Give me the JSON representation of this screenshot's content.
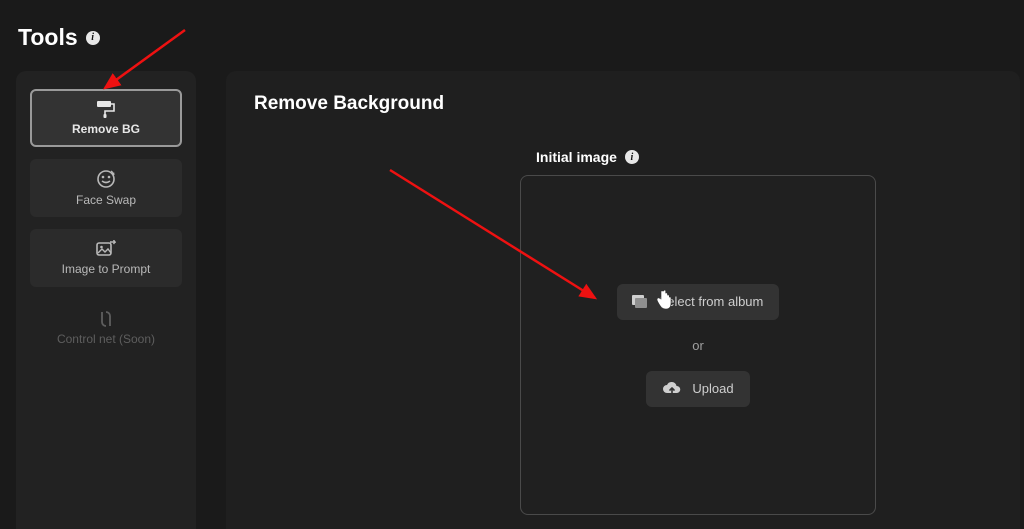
{
  "header": {
    "title": "Tools"
  },
  "sidebar": {
    "items": [
      {
        "label": "Remove BG",
        "active": true
      },
      {
        "label": "Face Swap",
        "active": false
      },
      {
        "label": "Image to Prompt",
        "active": false
      },
      {
        "label": "Control net (Soon)",
        "active": false,
        "disabled": true
      }
    ]
  },
  "main": {
    "title": "Remove Background",
    "section_label": "Initial image",
    "dropzone": {
      "select_from_album_label": "Select from album",
      "or_label": "or",
      "upload_label": "Upload"
    }
  }
}
